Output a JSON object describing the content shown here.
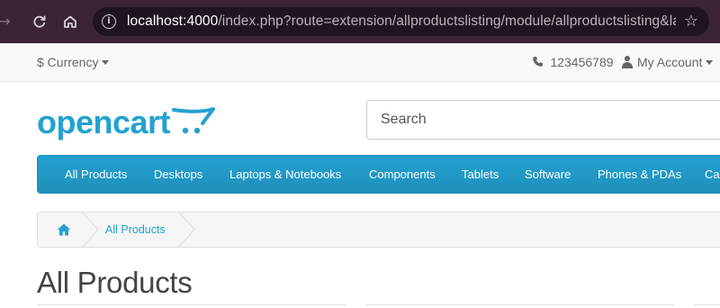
{
  "browser": {
    "url_host": "localhost:4000",
    "url_rest": "/index.php?route=extension/allproductslisting/module/allproductslisting&langu…",
    "icons": [
      "forward-icon",
      "reload-icon",
      "home-icon",
      "info-icon",
      "star-icon"
    ]
  },
  "topbar": {
    "currency_label": "$ Currency",
    "phone": "123456789",
    "account_label": "My Account"
  },
  "header": {
    "logo_text": "opencart",
    "search_placeholder": "Search",
    "brand_color": "#23a1d1"
  },
  "menu": {
    "items": [
      {
        "label": "All Products"
      },
      {
        "label": "Desktops"
      },
      {
        "label": "Laptops & Notebooks"
      },
      {
        "label": "Components"
      },
      {
        "label": "Tablets"
      },
      {
        "label": "Software"
      },
      {
        "label": "Phones & PDAs"
      },
      {
        "label": "Ca"
      }
    ]
  },
  "breadcrumb": {
    "items": [
      {
        "label": "All Products"
      }
    ]
  },
  "page": {
    "title": "All Products"
  }
}
